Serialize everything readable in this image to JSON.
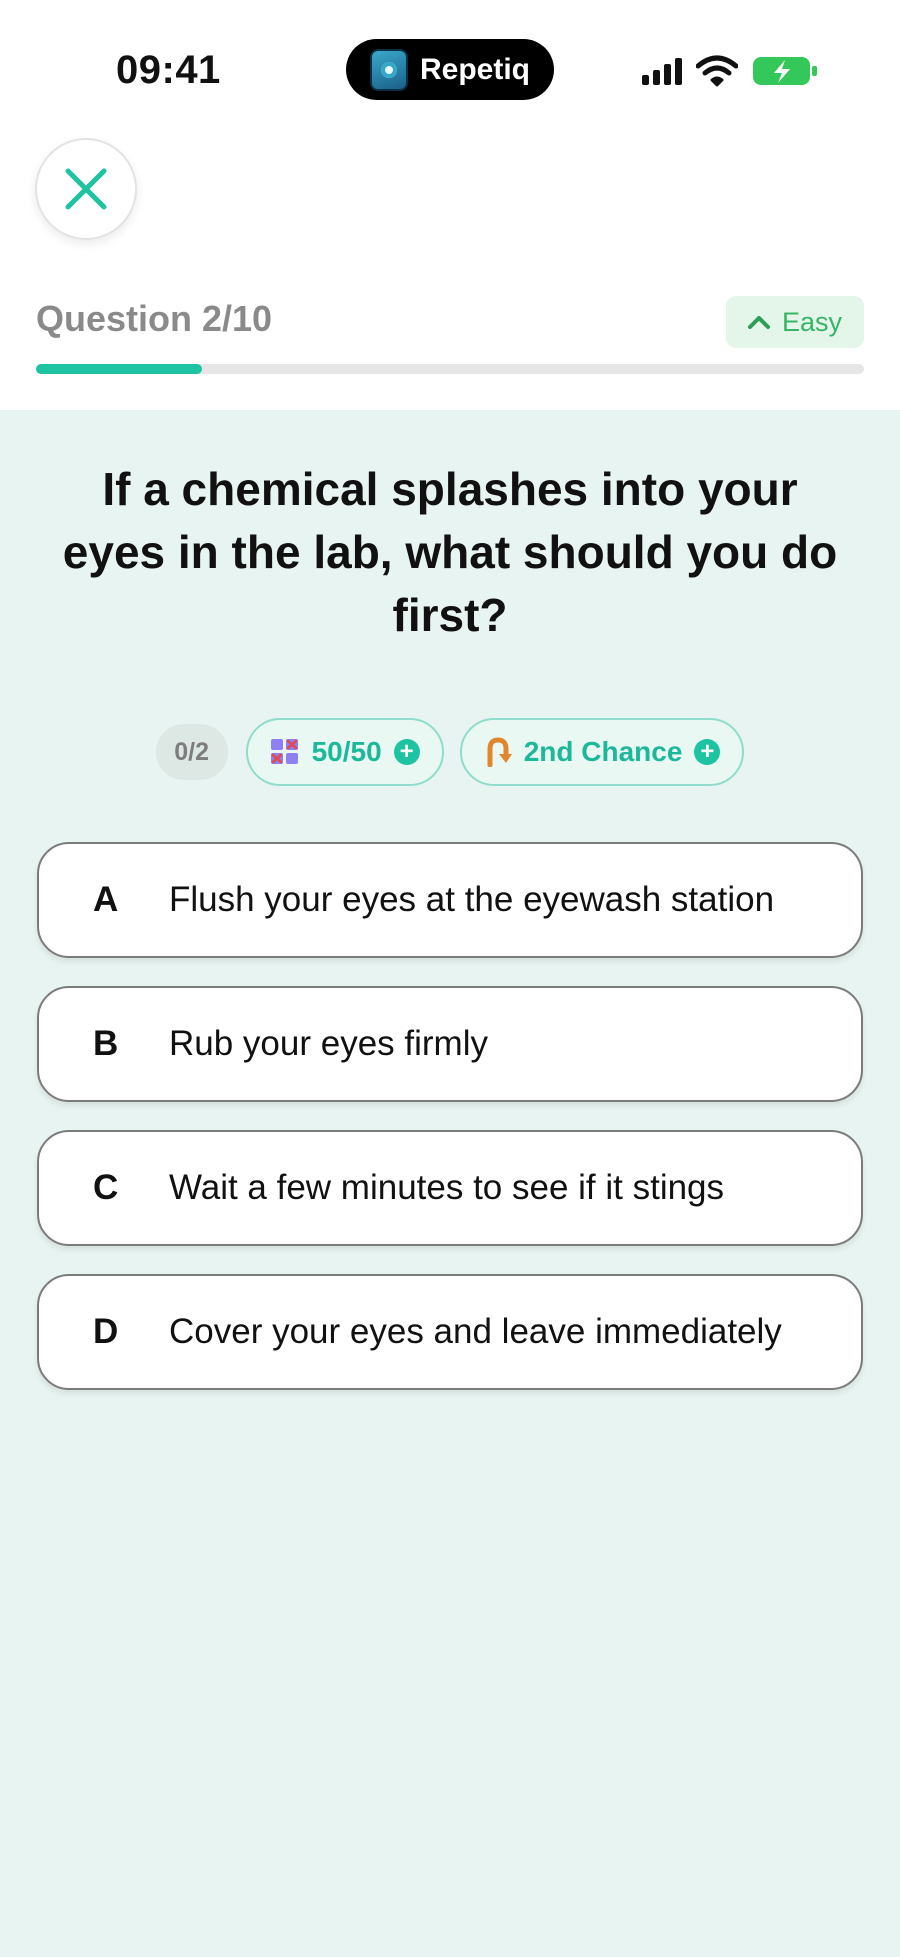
{
  "status_bar": {
    "time": "09:41",
    "app_name": "Repetiq",
    "battery_color": "#34c759"
  },
  "header": {
    "close_icon": "close-x-icon",
    "question_counter": "Question 2/10",
    "difficulty": "Easy",
    "difficulty_icon": "chevron-up-icon",
    "progress": 0.2,
    "accent_color": "#1ec3a1"
  },
  "question": {
    "text": "If a chemical splashes into your eyes in the lab, what should you do first?"
  },
  "lifelines": {
    "usage": "0/2",
    "fifty_fifty": {
      "label": "50/50",
      "icon": "fifty-fifty-icon"
    },
    "second_chance": {
      "label": "2nd Chance",
      "icon": "u-turn-arrow-icon"
    }
  },
  "answers": [
    {
      "letter": "A",
      "text": "Flush your eyes at the eyewash station"
    },
    {
      "letter": "B",
      "text": "Rub your eyes firmly"
    },
    {
      "letter": "C",
      "text": "Wait a few minutes to see if it stings"
    },
    {
      "letter": "D",
      "text": "Cover your eyes and leave immediately"
    }
  ]
}
